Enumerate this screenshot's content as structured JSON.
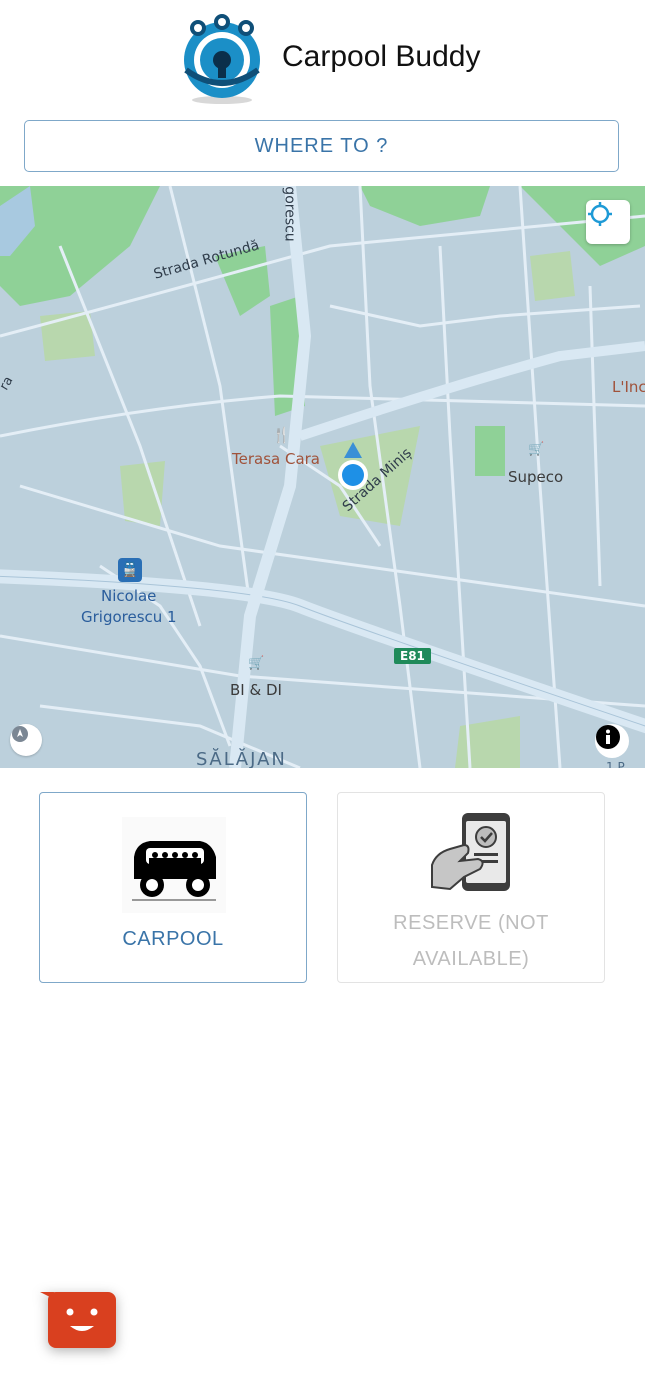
{
  "app": {
    "title": "Carpool Buddy"
  },
  "search": {
    "label": "WHERE TO ?"
  },
  "map": {
    "streets": [
      "Strada Rotundă",
      "gorescu",
      "Strada Miniș",
      "ra"
    ],
    "places": [
      "Terasa Cara",
      "Supeco",
      "L'Inc",
      "BI & DI"
    ],
    "station": {
      "line1": "Nicolae",
      "line2": "Grigorescu 1"
    },
    "road_badge": "E81",
    "district": "SĂLĂJAN",
    "corner_text": "1 P"
  },
  "options": {
    "carpool_label": "CARPOOL",
    "reserve_label": "RESERVE (NOT AVAILABLE)"
  },
  "colors": {
    "accent": "#3a74a8",
    "map_water": "#a8c9e0",
    "map_park": "#8fd197",
    "chat": "#d9401f",
    "location_dot": "#1e90e6"
  }
}
